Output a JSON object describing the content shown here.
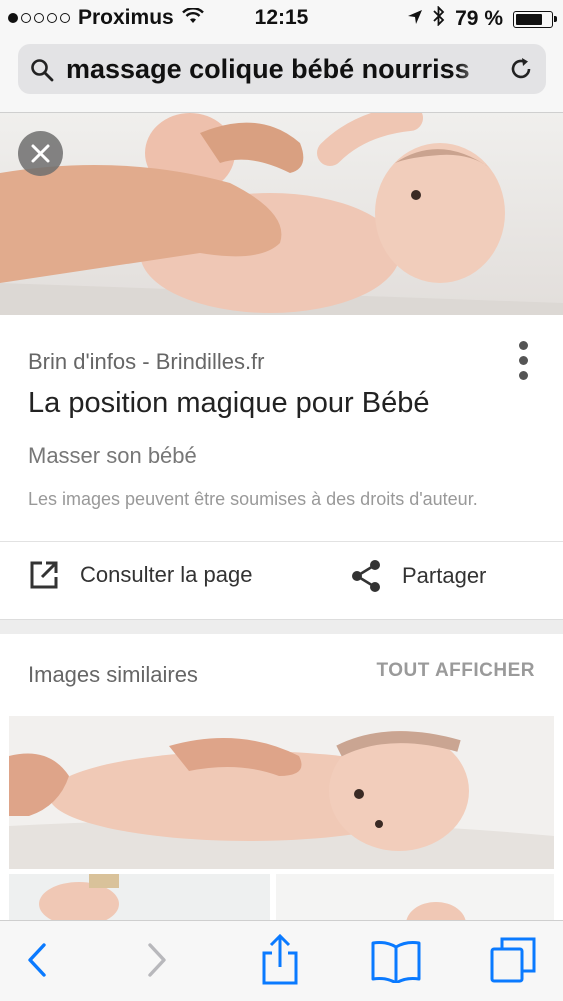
{
  "status_bar": {
    "carrier": "Proximus",
    "time": "12:15",
    "battery_percent": "79 %",
    "battery_level": 0.79
  },
  "url_bar": {
    "query": "massage colique bébé nourriss"
  },
  "result": {
    "source": "Brin d'infos - Brindilles.fr",
    "title": "La position magique pour Bébé",
    "subtitle": "Masser son bébé",
    "copyright_notice": "Les images peuvent être soumises à des droits d'auteur.",
    "visit_label": "Consulter la page",
    "share_label": "Partager"
  },
  "similar": {
    "title": "Images similaires",
    "show_all_label": "TOUT AFFICHER"
  },
  "colors": {
    "ios_blue": "#0a7aff",
    "disabled_gray": "#b8b8bc"
  },
  "icons": {
    "search": "search-icon",
    "reload": "reload-icon",
    "close": "close-icon",
    "more": "more-vertical-icon",
    "open_external": "open-external-icon",
    "share": "share-icon",
    "back": "back-icon",
    "forward": "forward-icon",
    "share_sheet": "share-sheet-icon",
    "bookmarks": "bookmarks-icon",
    "tabs": "tabs-icon"
  }
}
